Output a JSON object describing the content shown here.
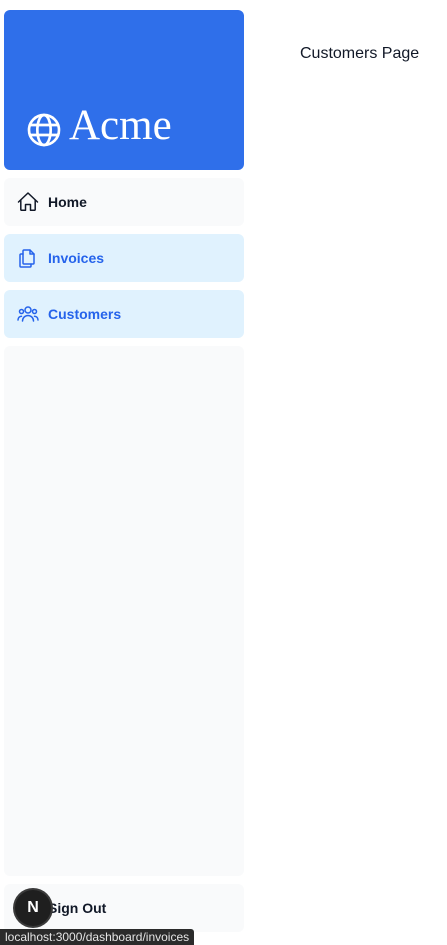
{
  "brand": {
    "name": "Acme",
    "icon": "globe-icon",
    "color": "#2f6fea"
  },
  "nav": {
    "items": [
      {
        "label": "Home",
        "icon": "home-icon",
        "active": false
      },
      {
        "label": "Invoices",
        "icon": "document-duplicate-icon",
        "active": false
      },
      {
        "label": "Customers",
        "icon": "user-group-icon",
        "active": false
      }
    ],
    "active_color": "#2563eb",
    "highlight_bg": "#e0f2fe"
  },
  "signout": {
    "label": "Sign Out",
    "icon": "power-icon"
  },
  "main": {
    "heading": "Customers Page"
  },
  "devtools": {
    "badge_letter": "N"
  },
  "status_bar": {
    "url": "localhost:3000/dashboard/invoices"
  }
}
